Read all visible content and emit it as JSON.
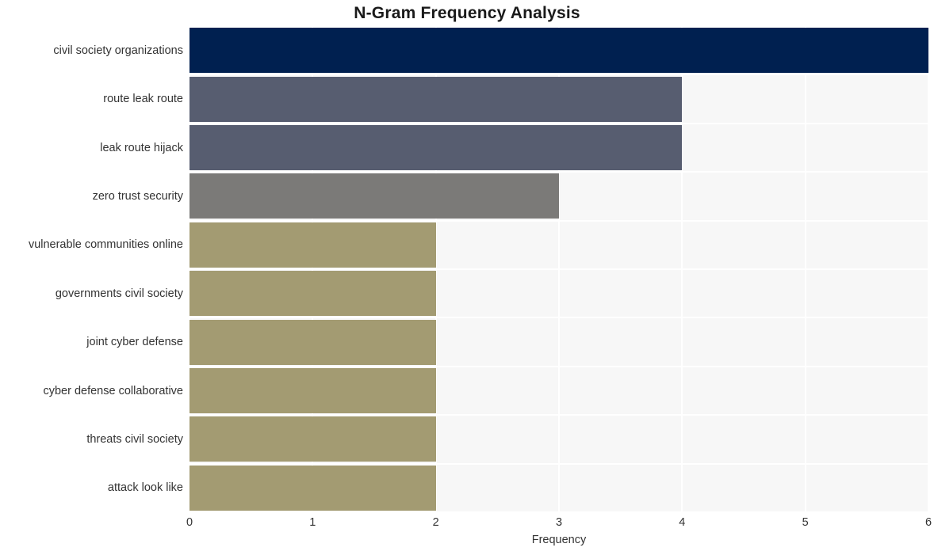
{
  "chart_data": {
    "type": "bar",
    "orientation": "horizontal",
    "title": "N-Gram Frequency Analysis",
    "xlabel": "Frequency",
    "ylabel": "",
    "categories": [
      "civil society organizations",
      "route leak route",
      "leak route hijack",
      "zero trust security",
      "vulnerable communities online",
      "governments civil society",
      "joint cyber defense",
      "cyber defense collaborative",
      "threats civil society",
      "attack look like"
    ],
    "values": [
      6,
      4,
      4,
      3,
      2,
      2,
      2,
      2,
      2,
      2
    ],
    "bar_colors": [
      "#002050",
      "#575d70",
      "#575d70",
      "#7b7a78",
      "#a39b72",
      "#a39b72",
      "#a39b72",
      "#a39b72",
      "#a39b72",
      "#a39b72"
    ],
    "xlim": [
      0,
      6
    ],
    "xticks": [
      "0",
      "1",
      "2",
      "3",
      "4",
      "5",
      "6"
    ],
    "xtick_values": [
      0,
      1,
      2,
      3,
      4,
      5,
      6
    ],
    "grid": true,
    "legend": false,
    "plot_background": "#f7f7f7",
    "grid_color": "#ffffff",
    "figure_background": "#ffffff",
    "title_color": "#1a1a1a",
    "tick_label_color": "#333333"
  }
}
